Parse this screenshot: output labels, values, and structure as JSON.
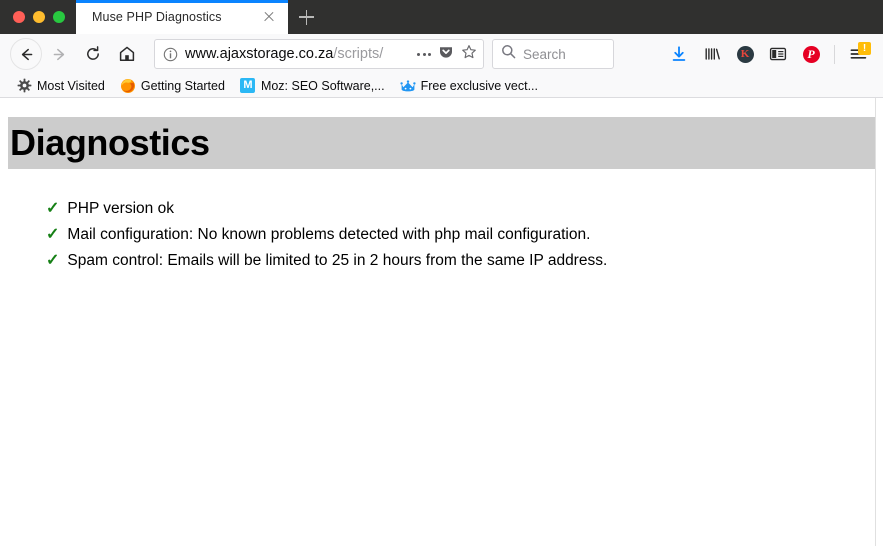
{
  "window": {
    "controls": [
      "close",
      "minimize",
      "maximize"
    ]
  },
  "tabs": [
    {
      "title": "Muse PHP Diagnostics",
      "active": true
    }
  ],
  "newtab_label": "+",
  "navigation": {
    "back_label": "Back",
    "forward_label": "Forward",
    "reload_label": "Reload",
    "home_label": "Home"
  },
  "urlbar": {
    "host": "www.ajaxstorage.co.za",
    "path": "/scripts/",
    "full_url": "www.ajaxstorage.co.za/scripts/",
    "page_actions_label": "...",
    "pocket_label": "Save to Pocket",
    "bookmark_label": "Bookmark this page"
  },
  "search": {
    "placeholder": "Search"
  },
  "toolbar_icons": [
    {
      "name": "downloads-icon",
      "label": "Downloads"
    },
    {
      "name": "library-icon",
      "label": "Library"
    },
    {
      "name": "kaspersky-icon",
      "label": "K"
    },
    {
      "name": "sidebar-icon",
      "label": "Sidebars"
    },
    {
      "name": "pinterest-icon",
      "label": "P"
    },
    {
      "name": "menu-icon",
      "label": "Open menu",
      "badge": "!"
    }
  ],
  "bookmarks": [
    {
      "label": "Most Visited",
      "icon": "gear-icon"
    },
    {
      "label": "Getting Started",
      "icon": "firefox-icon"
    },
    {
      "label": "Moz: SEO Software,...",
      "icon": "moz-icon"
    },
    {
      "label": "Free exclusive vect...",
      "icon": "crown-icon"
    }
  ],
  "page": {
    "heading": "Diagnostics",
    "banner_color": "#cccccc",
    "check_color": "#168016",
    "items": [
      {
        "check": "✓",
        "text": "PHP version ok"
      },
      {
        "check": "✓",
        "text": "Mail configuration: No known problems detected with php mail configuration."
      },
      {
        "check": "✓",
        "text": "Spam control: Emails will be limited to 25 in 2 hours from the same IP address."
      }
    ]
  }
}
